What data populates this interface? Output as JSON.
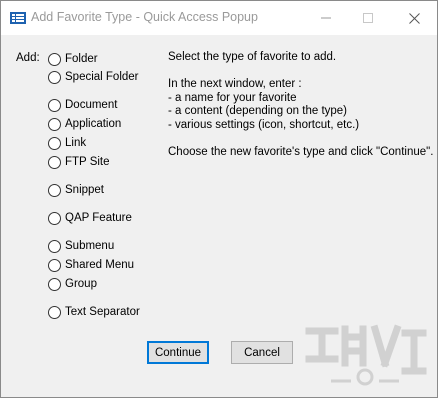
{
  "window": {
    "title": "Add Favorite Type - Quick Access Popup"
  },
  "form": {
    "add_label": "Add:",
    "options": [
      {
        "label": "Folder"
      },
      {
        "label": "Special Folder"
      },
      {
        "label": "Document"
      },
      {
        "label": "Application"
      },
      {
        "label": "Link"
      },
      {
        "label": "FTP Site"
      },
      {
        "label": "Snippet"
      },
      {
        "label": "QAP Feature"
      },
      {
        "label": "Submenu"
      },
      {
        "label": "Shared Menu"
      },
      {
        "label": "Group"
      },
      {
        "label": "Text Separator"
      }
    ]
  },
  "instructions": {
    "line1": "Select the type of favorite to add.",
    "line2": "In the next window, enter :",
    "line3": "- a name for your favorite",
    "line4": "- a content (depending on the type)",
    "line5": "- various settings (icon, shortcut, etc.)",
    "line6": "Choose the new favorite's type and click \"Continue\"."
  },
  "buttons": {
    "continue_label": "Continue",
    "cancel_label": "Cancel"
  },
  "icons": {
    "app": "app-icon",
    "minimize": "minimize-icon",
    "maximize": "maximize-icon",
    "close": "close-icon",
    "watermark": "watermark-logo"
  },
  "colors": {
    "accent": "#0078d7",
    "window_bg": "#f0f0f0",
    "button_bg": "#e1e1e1"
  }
}
